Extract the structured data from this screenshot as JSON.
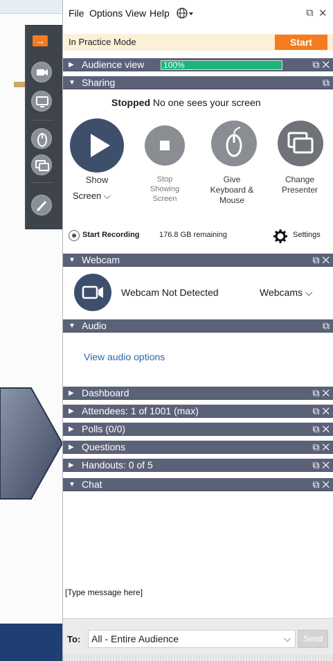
{
  "menu": {
    "file": "File",
    "options": "Options",
    "view": "View",
    "help": "Help",
    "globe_icon": "globe-icon",
    "restore_ctrl": "⧉",
    "close_ctrl": "✕"
  },
  "practice": {
    "text": "In Practice Mode",
    "start_label": "Start"
  },
  "sections": {
    "audience_view": "Audience view",
    "audience_zoom": "100%",
    "sharing": "Sharing",
    "webcam": "Webcam",
    "audio": "Audio",
    "dashboard": "Dashboard",
    "attendees": "Attendees: 1 of 1001 (max)",
    "polls": "Polls (0/0)",
    "questions": "Questions",
    "handouts": "Handouts: 0 of 5",
    "chat": "Chat"
  },
  "sharing": {
    "status_bold": "Stopped",
    "status_text": "No one sees your screen",
    "show_label": "Show",
    "screen_select": "Screen",
    "stop_line1": "Stop",
    "stop_line2": "Showing",
    "stop_line3": "Screen",
    "give_line1": "Give",
    "give_line2": "Keyboard &",
    "give_line3": "Mouse",
    "change_line1": "Change",
    "change_line2": "Presenter"
  },
  "recording": {
    "label": "Start Recording",
    "remaining": "176.8 GB remaining",
    "settings_label": "Settings"
  },
  "webcam": {
    "status": "Webcam Not Detected",
    "dropdown": "Webcams"
  },
  "audio": {
    "link": "View audio options"
  },
  "chat": {
    "placeholder": "[Type message here]",
    "to_label": "To:",
    "to_value": "All - Entire Audience",
    "send_label": "Send"
  },
  "colors": {
    "accent_orange": "#f47b20",
    "header_bg": "#5b6278",
    "audience_green": "#1db37b",
    "practice_bg": "#fdf0d9",
    "toolbar_dark": "#3f434c"
  }
}
